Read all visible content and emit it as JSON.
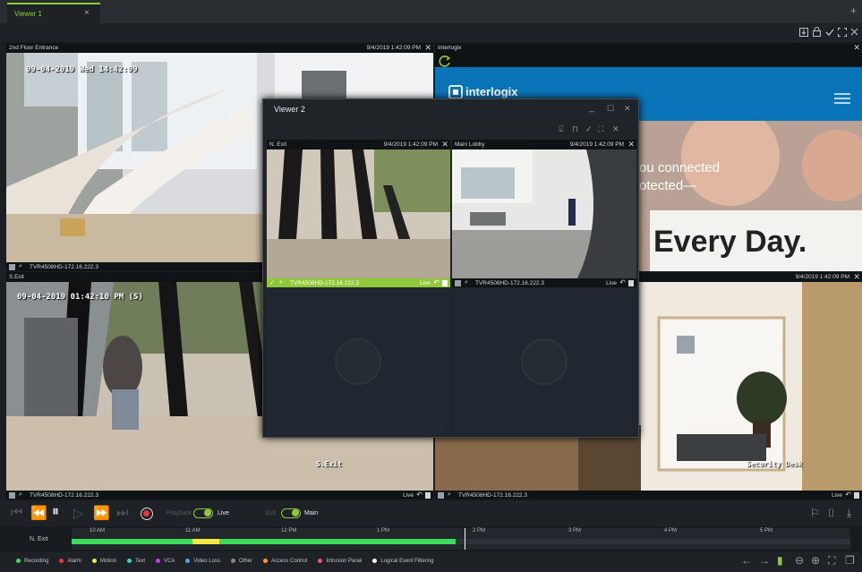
{
  "tabs": [
    {
      "label": "Viewer 1",
      "close": "×"
    }
  ],
  "add_tab": "+",
  "toolbar_icons": [
    "download-icon",
    "lock-icon",
    "check-icon",
    "fullscreen-icon",
    "close-icon"
  ],
  "tiles": {
    "top_left": {
      "name": "2nd Floor Entrance",
      "timestamp": "9/4/2019 1:42:09 PM",
      "device": "TVR4508HD-172.16.222.3",
      "osd": "09-04-2019 Wed 14:42:09"
    },
    "top_right": {
      "name": "Interlogix",
      "brand": "interlogix",
      "banner_line1": "ou connected",
      "banner_line2": "otected—",
      "banner_big": "Every Day."
    },
    "bottom_left": {
      "name": "S.Exit",
      "device": "TVR4508HD-172.16.222.3",
      "live": "Live",
      "osd": "09-04-2019 01:42:10 PM (S)",
      "overlay": "S.Exit"
    },
    "bottom_right": {
      "timestamp": "9/4/2019 1:42:09 PM",
      "device": "TVR4508HD-172.16.222.3",
      "live": "Live",
      "overlay": "Security Desk"
    }
  },
  "viewer2": {
    "title": "Viewer 2",
    "tiles": [
      {
        "name": "N. Exit",
        "timestamp": "9/4/2019 1:42:09 PM",
        "device": "TVR4508HD-172.16.222.3",
        "live": "Live",
        "selected": true
      },
      {
        "name": "Main Lobby",
        "timestamp": "9/4/2019 1:42:09 PM",
        "device": "TVR4508HD-172.16.222.3",
        "live": "Live",
        "selected": false
      }
    ]
  },
  "controls": {
    "playback_label": "Playback",
    "live_label": "Live",
    "sub_label": "Sub",
    "main_label": "Main"
  },
  "timeline": {
    "camera": "N. Exit",
    "hours": [
      "10 AM",
      "11 AM",
      "12 PM",
      "1 PM",
      "2 PM",
      "3 PM",
      "4 PM",
      "5 PM"
    ],
    "current_fraction": 0.505
  },
  "legend": [
    {
      "label": "Recording",
      "color": "#3ddc5a"
    },
    {
      "label": "Alarm",
      "color": "#e53935"
    },
    {
      "label": "Motion",
      "color": "#f4e842"
    },
    {
      "label": "Text",
      "color": "#3ad0c0"
    },
    {
      "label": "VCA",
      "color": "#c040e0"
    },
    {
      "label": "Video Loss",
      "color": "#4aa3ff"
    },
    {
      "label": "Other",
      "color": "#888888"
    },
    {
      "label": "Access Control",
      "color": "#ff9a2e"
    },
    {
      "label": "Intrusion Panel",
      "color": "#ff4a6a"
    },
    {
      "label": "Logical Event Filtering",
      "color": "#ffffff"
    }
  ],
  "accent_color": "#8fc93a"
}
